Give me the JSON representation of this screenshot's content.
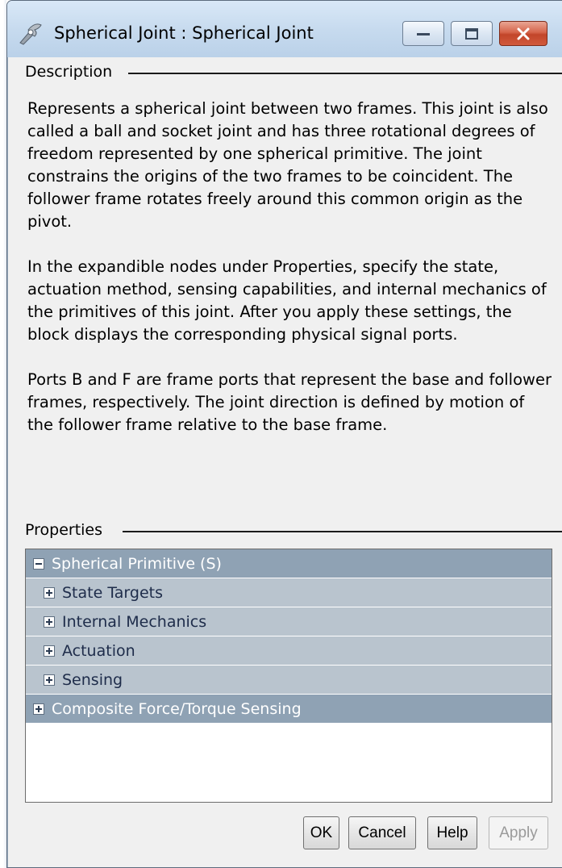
{
  "window": {
    "title": "Spherical Joint : Spherical Joint"
  },
  "description": {
    "label": "Description",
    "paragraphs": [
      "Represents a spherical joint between two frames. This joint is also called a ball and socket joint and has three rotational degrees of freedom represented by one spherical primitive. The joint constrains the origins of the two frames to be coincident. The follower frame rotates freely around this common origin as the pivot.",
      "In the expandible nodes under Properties, specify the state, actuation method, sensing capabilities, and internal mechanics of the primitives of this joint. After you apply these settings, the block displays the corresponding physical signal ports.",
      "Ports B and F are frame ports that represent the base and follower frames, respectively. The joint direction is defined by motion of the follower frame relative to the base frame."
    ]
  },
  "properties": {
    "label": "Properties",
    "nodes": [
      {
        "label": "Spherical Primitive (S)",
        "level": "top",
        "expanded": true
      },
      {
        "label": "State Targets",
        "level": "sub",
        "expanded": false
      },
      {
        "label": "Internal Mechanics",
        "level": "sub",
        "expanded": false
      },
      {
        "label": "Actuation",
        "level": "sub",
        "expanded": false
      },
      {
        "label": "Sensing",
        "level": "sub",
        "expanded": false
      },
      {
        "label": "Composite Force/Torque Sensing",
        "level": "top",
        "expanded": false
      }
    ]
  },
  "buttons": {
    "ok": "OK",
    "cancel": "Cancel",
    "help": "Help",
    "apply": "Apply"
  },
  "icons": {
    "app": "spherical-joint-icon",
    "minimize": "minimize-icon",
    "maximize": "maximize-icon",
    "close": "close-icon"
  },
  "colors": {
    "tree_top_row": "#8fa2b4",
    "tree_sub_row": "#b9c4ce",
    "close_button": "#c2452a"
  }
}
